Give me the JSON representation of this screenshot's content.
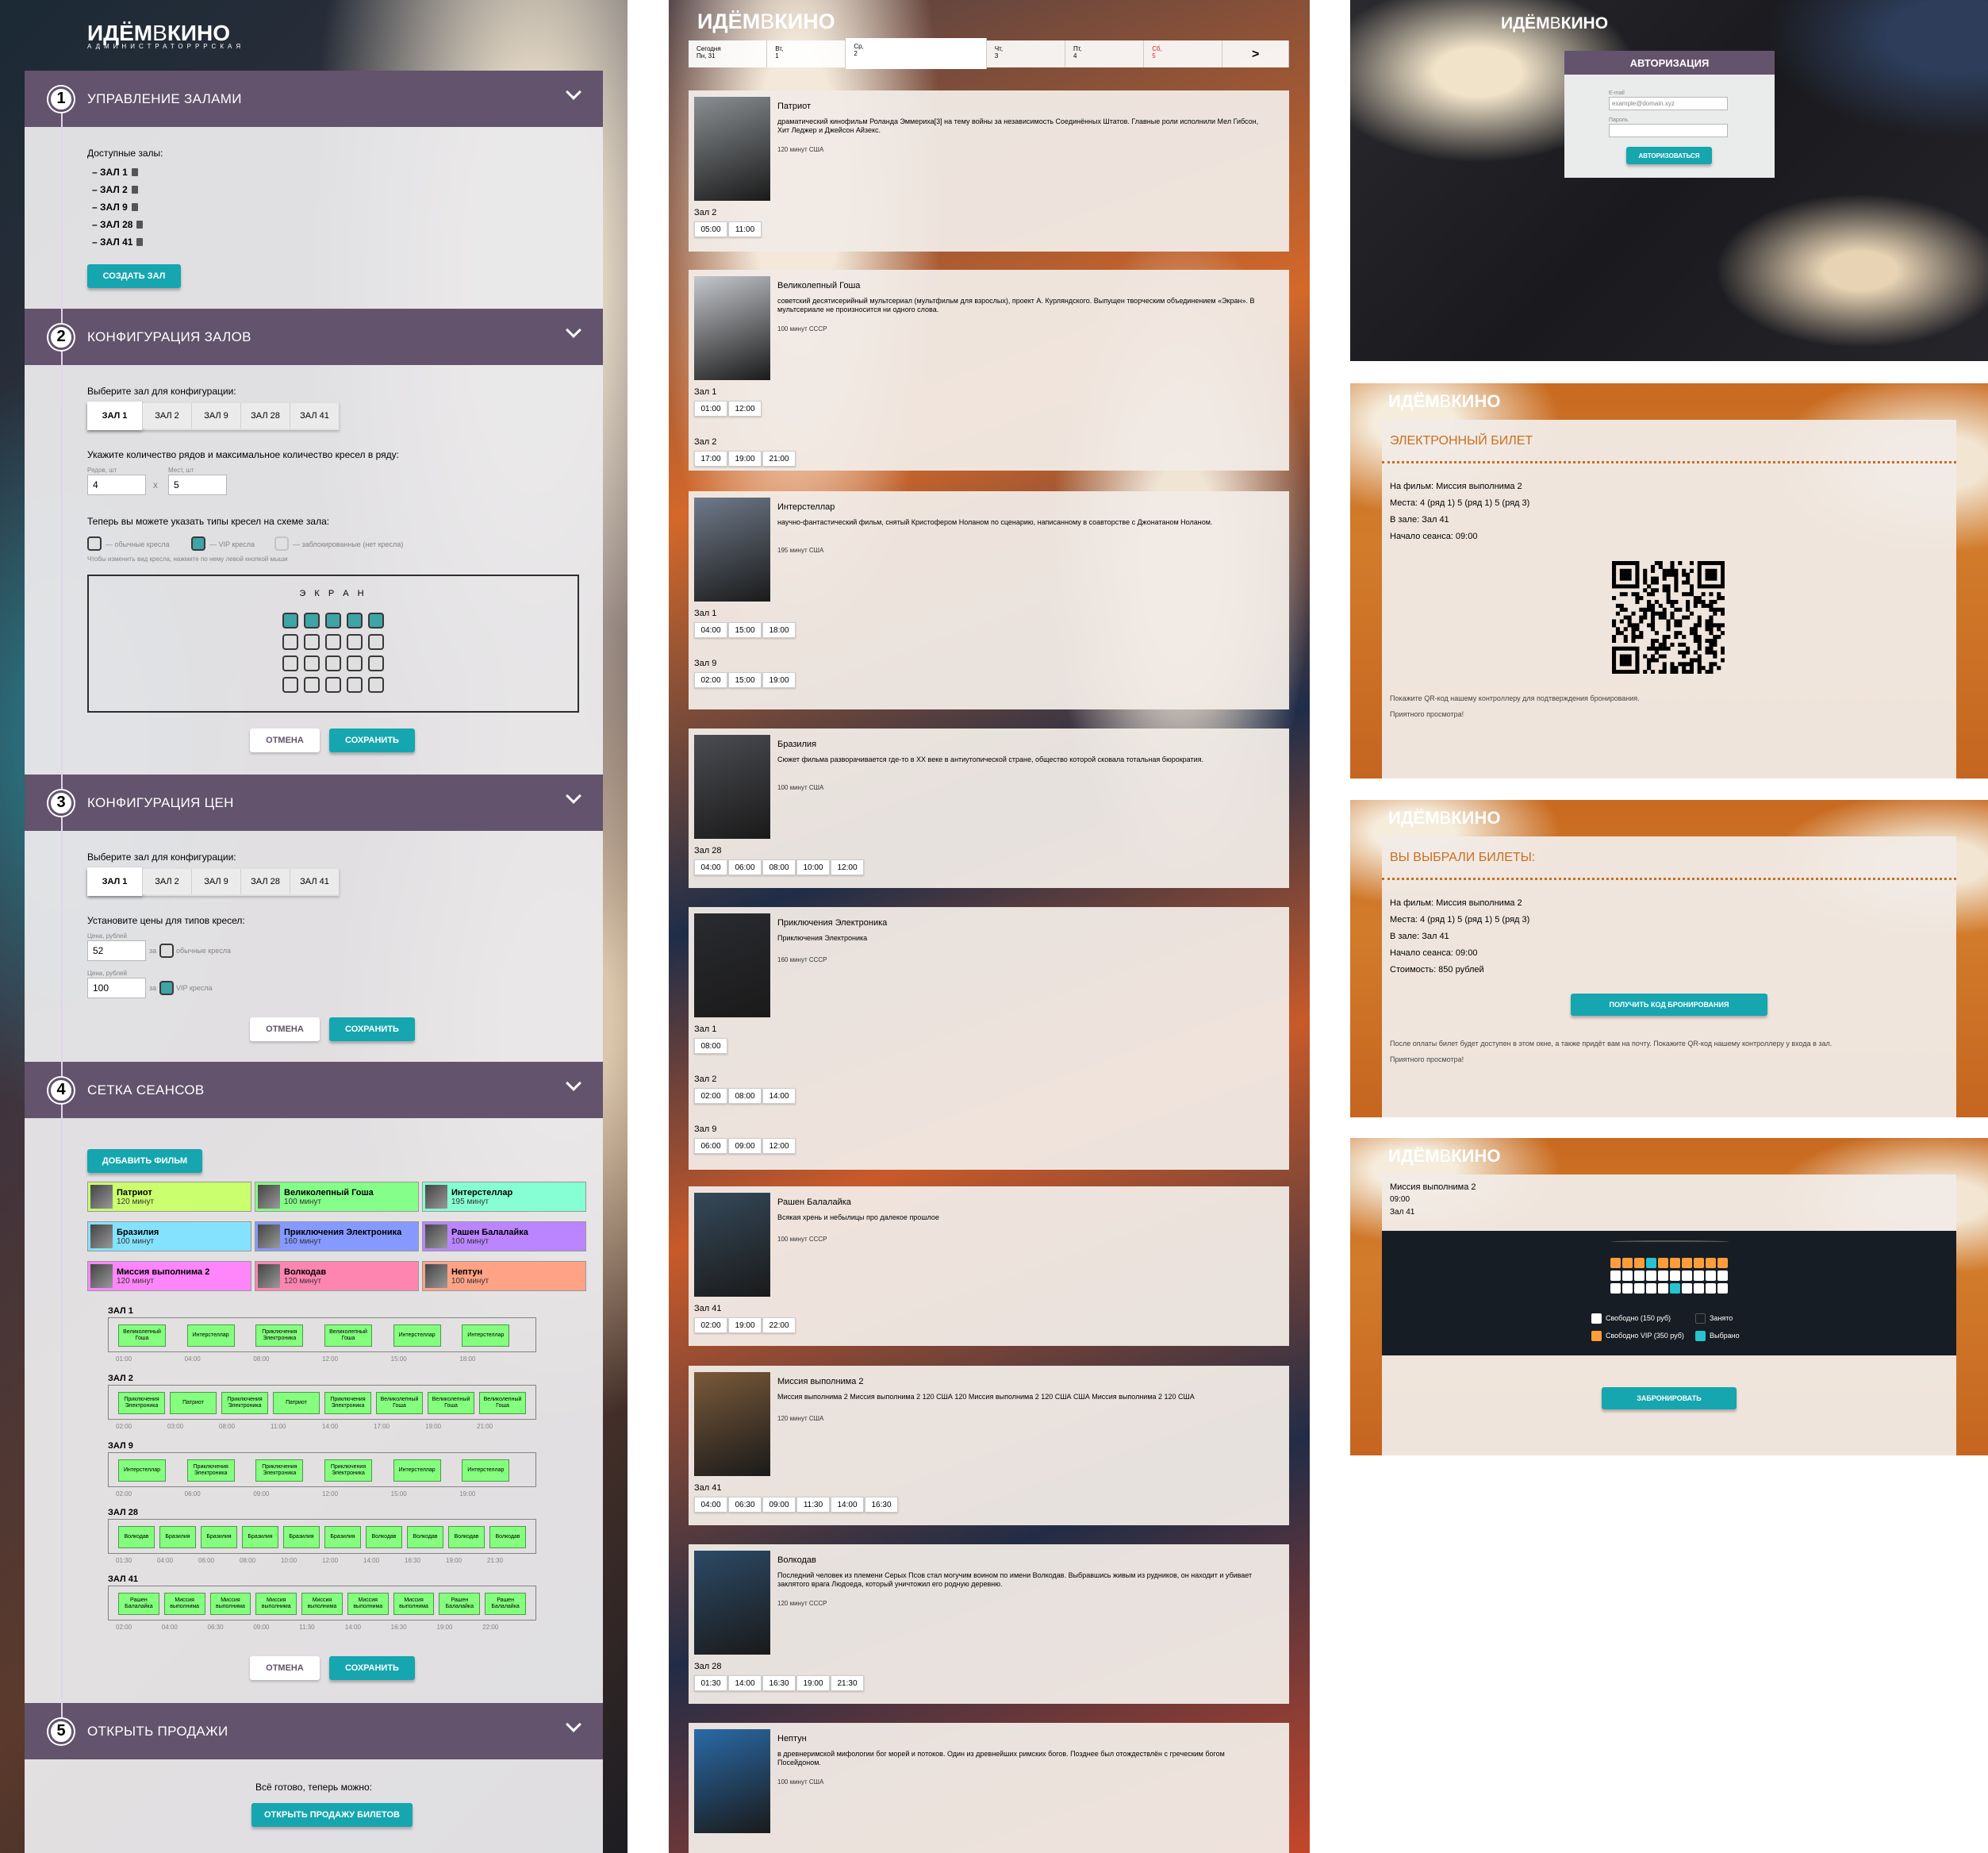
{
  "brand": {
    "logo_pre": "ИДЁМ",
    "logo_v": "В",
    "logo_post": "КИНО",
    "admin_sub": "Администраторррская"
  },
  "admin": {
    "sections": [
      {
        "num": "1",
        "title": "Управление залами"
      },
      {
        "num": "2",
        "title": "Конфигурация залов"
      },
      {
        "num": "3",
        "title": "Конфигурация цен"
      },
      {
        "num": "4",
        "title": "Сетка сеансов"
      },
      {
        "num": "5",
        "title": "Открыть продажи"
      }
    ],
    "halls_label": "Доступные залы:",
    "halls": [
      "– Зал 1",
      "– Зал 2",
      "– Зал 9",
      "– Зал 28",
      "– Зал 41"
    ],
    "create_hall": "Создать зал",
    "choose_hall": "Выберите зал для конфигурации:",
    "hall_tabs": [
      "Зал 1",
      "Зал 2",
      "Зал 9",
      "Зал 28",
      "Зал 41"
    ],
    "rows_text": "Укажите количество рядов и максимальное количество кресел в ряду:",
    "rows_lbl": "Рядов, шт",
    "seats_lbl": "Мест, шт",
    "rows_val": "4",
    "seats_val": "5",
    "times_x": "x",
    "types_text": "Теперь вы можете указать типы кресел на схеме зала:",
    "legend_std": "— обычные кресла",
    "legend_vip": "— VIP кресла",
    "legend_block": "— заблокированные (нет кресла)",
    "hint": "Чтобы изменить вид кресла, нажмите по нему левой кнопкой мыши",
    "screen": "Э К Р А Н",
    "cancel": "Отмена",
    "save": "Сохранить",
    "prices_text": "Установите цены для типов кресел:",
    "price_lbl": "Цена, рублей",
    "price_std": "52",
    "price_vip": "100",
    "price_for": "за",
    "price_std_lbl": "обычные кресла",
    "price_vip_lbl": "VIP кресла",
    "add_film": "Добавить фильм",
    "films": [
      {
        "title": "Патриот",
        "dur": "120 минут",
        "color": "#caff6d"
      },
      {
        "title": "Великолепный Гоша",
        "dur": "100 минут",
        "color": "#85ff89"
      },
      {
        "title": "Интерстеллар",
        "dur": "195 минут",
        "color": "#85ffd3"
      },
      {
        "title": "Бразилия",
        "dur": "100 минут",
        "color": "#85e2ff"
      },
      {
        "title": "Приключения Электроника",
        "dur": "160 минут",
        "color": "#8599ff"
      },
      {
        "title": "Рашен Балалайка",
        "dur": "100 минут",
        "color": "#ba85ff"
      },
      {
        "title": "Миссия выполнима 2",
        "dur": "120 минут",
        "color": "#ff85fb"
      },
      {
        "title": "Волкодав",
        "dur": "120 минут",
        "color": "#ff85b1"
      },
      {
        "title": "Нептун",
        "dur": "100 минут",
        "color": "#ffa285"
      }
    ],
    "grid": [
      {
        "hall": "Зал 1",
        "sessions": [
          "Великолепный Гоша",
          "Интерстеллар",
          "Приключения Электроника",
          "Великолепный Гоша",
          "Интерстеллар",
          "Интерстеллар"
        ],
        "times": [
          "01:00",
          "04:00",
          "08:00",
          "12:00",
          "15:00",
          "18:00"
        ]
      },
      {
        "hall": "Зал 2",
        "sessions": [
          "Приключения Электроника",
          "Патриот",
          "Приключения Электроника",
          "Патриот",
          "Приключения Электроника",
          "Великолепный Гоша",
          "Великолепный Гоша",
          "Великолепный Гоша"
        ],
        "times": [
          "02:00",
          "03:00",
          "08:00",
          "11:00",
          "14:00",
          "17:00",
          "19:00",
          "21:00"
        ]
      },
      {
        "hall": "Зал 9",
        "sessions": [
          "Интерстеллар",
          "Приключения Электроника",
          "Приключения Электроника",
          "Приключения Электроника",
          "Интерстеллар",
          "Интерстеллар"
        ],
        "times": [
          "02:00",
          "06:00",
          "09:00",
          "12:00",
          "15:00",
          "19:00"
        ]
      },
      {
        "hall": "Зал 28",
        "sessions": [
          "Волкодав",
          "Бразилия",
          "Бразилия",
          "Бразилия",
          "Бразилия",
          "Бразилия",
          "Волкодав",
          "Волкодав",
          "Волкодав",
          "Волкодав"
        ],
        "times": [
          "01:30",
          "04:00",
          "06:00",
          "08:00",
          "10:00",
          "12:00",
          "14:00",
          "16:30",
          "19:00",
          "21:30"
        ]
      },
      {
        "hall": "Зал 41",
        "sessions": [
          "Рашен Балалайка",
          "Миссия выполнима",
          "Миссия выполнима",
          "Миссия выполнима",
          "Миссия выполнима",
          "Миссия выполнима",
          "Миссия выполнима",
          "Рашен Балалайка",
          "Рашен Балалайка"
        ],
        "times": [
          "02:00",
          "04:00",
          "06:30",
          "09:00",
          "11:30",
          "14:00",
          "16:30",
          "19:00",
          "22:00"
        ]
      }
    ],
    "ready": "Всё готово, теперь можно:",
    "open_sales": "Открыть продажу билетов"
  },
  "client": {
    "days": [
      {
        "line1": "Сегодня",
        "line2": "Пн, 31"
      },
      {
        "line1": "Вт,",
        "line2": "1"
      },
      {
        "line1": "Ср,",
        "line2": "2"
      },
      {
        "line1": "Чт,",
        "line2": "3"
      },
      {
        "line1": "Пт,",
        "line2": "4"
      },
      {
        "line1": "Сб,",
        "line2": "5"
      }
    ],
    "next": ">",
    "movies": [
      {
        "title": "Патриот",
        "desc": "драматический кинофильм Роланда Эммериха[3] на тему войны за независимость Соединённых Штатов. Главные роли исполнили Мел Гибсон, Хит Леджер и Джейсон Айзекс.",
        "data": "120 минут США",
        "halls": [
          {
            "name": "Зал 2",
            "times": [
              "05:00",
              "11:00"
            ]
          }
        ]
      },
      {
        "title": "Великолепный Гоша",
        "desc": "советский десятисерийный мультсериал (мультфильм для взрослых), проект А. Курляндского. Выпущен творческим объединением «Экран». В мультсериале не произносится ни одного слова.",
        "data": "100 минут СССР",
        "halls": [
          {
            "name": "Зал 1",
            "times": [
              "01:00",
              "12:00"
            ]
          },
          {
            "name": "Зал 2",
            "times": [
              "17:00",
              "19:00",
              "21:00"
            ]
          }
        ]
      },
      {
        "title": "Интерстеллар",
        "desc": "научно-фантастический фильм, снятый Кристофером Ноланом по сценарию, написанному в соавторстве с Джонатаном Ноланом.",
        "data": "195 минут США",
        "halls": [
          {
            "name": "Зал 1",
            "times": [
              "04:00",
              "15:00",
              "18:00"
            ]
          },
          {
            "name": "Зал 9",
            "times": [
              "02:00",
              "15:00",
              "19:00"
            ]
          }
        ]
      },
      {
        "title": "Бразилия",
        "desc": "Сюжет фильма разворачивается где-то в XX веке в антиутопической стране, общество которой сковала тотальная бюрократия.",
        "data": "100 минут США",
        "halls": [
          {
            "name": "Зал 28",
            "times": [
              "04:00",
              "06:00",
              "08:00",
              "10:00",
              "12:00"
            ]
          }
        ]
      },
      {
        "title": "Приключения Электроника",
        "desc": "Приключения Электроника",
        "data": "160 минут СССР",
        "halls": [
          {
            "name": "Зал 1",
            "times": [
              "08:00"
            ]
          },
          {
            "name": "Зал 2",
            "times": [
              "02:00",
              "08:00",
              "14:00"
            ]
          },
          {
            "name": "Зал 9",
            "times": [
              "06:00",
              "09:00",
              "12:00"
            ]
          }
        ]
      },
      {
        "title": "Рашен Балалайка",
        "desc": "Всякая хрень и небылицы про далекое прошлое",
        "data": "100 минут СССР",
        "halls": [
          {
            "name": "Зал 41",
            "times": [
              "02:00",
              "19:00",
              "22:00"
            ]
          }
        ]
      },
      {
        "title": "Миссия выполнима 2",
        "desc": "Миссия выполнима 2 Миссия выполнима 2 120 США 120 Миссия выполнима 2 120 США США Миссия выполнима 2 120 США",
        "data": "120 минут США",
        "halls": [
          {
            "name": "Зал 41",
            "times": [
              "04:00",
              "06:30",
              "09:00",
              "11:30",
              "14:00",
              "16:30"
            ]
          }
        ]
      },
      {
        "title": "Волкодав",
        "desc": "Последний человек из племени Серых Псов стал могучим воином по имени Волкодав. Выбравшись живым из рудников, он находит и убивает заклятого врага Людоеда, который уничтожил его родную деревню.",
        "data": "120 минут СССР",
        "halls": [
          {
            "name": "Зал 28",
            "times": [
              "01:30",
              "14:00",
              "16:30",
              "19:00",
              "21:30"
            ]
          }
        ]
      },
      {
        "title": "Нептун",
        "desc": "в древнеримской мифологии бог морей и потоков. Один из древнейших римских богов. Позднее был отождествлён с греческим богом Посейдоном.",
        "data": "100 минут США",
        "halls": []
      }
    ]
  },
  "login": {
    "title": "Авторизация",
    "email_lbl": "E-mail",
    "email_ph": "example@domain.xyz",
    "pass_lbl": "Пароль",
    "submit": "Авторизоваться"
  },
  "ticket": {
    "head": "Электронный билет",
    "film": "На фильм: Миссия выполнима 2",
    "places": "Места: 4 (ряд 1) 5 (ряд 1) 5 (ряд 3)",
    "hall": "В зале: Зал 41",
    "start": "Начало сеанса: 09:00",
    "note1": "Покажите QR-код нашему контроллеру для подтверждения бронирования.",
    "note2": "Приятного просмотра!"
  },
  "payment": {
    "head": "Вы выбрали билеты:",
    "film": "На фильм: Миссия выполнима 2",
    "places": "Места: 4 (ряд 1) 5 (ряд 1) 5 (ряд 3)",
    "hall": "В зале: Зал 41",
    "start": "Начало сеанса: 09:00",
    "cost": "Стоимость: 850 рублей",
    "button": "Получить код бронирования",
    "note1": "После оплаты билет будет доступен в этом окне, а также придёт вам на почту. Покажите QR-код нашему контроллеру у входа в зал.",
    "note2": "Приятного просмотра!"
  },
  "hall_page": {
    "film": "Миссия выполнима 2",
    "time": "09:00",
    "hall": "Зал 41",
    "legend_free": "Свободно (150 руб)",
    "legend_vip": "Свободно VIP (350 руб)",
    "legend_taken": "Занято",
    "legend_chosen": "Выбрано",
    "button": "Забронировать"
  },
  "colors": {
    "accent": "#16a6af",
    "header": "#63536c",
    "orange": "#c76f22",
    "session": "#84ff7e"
  }
}
